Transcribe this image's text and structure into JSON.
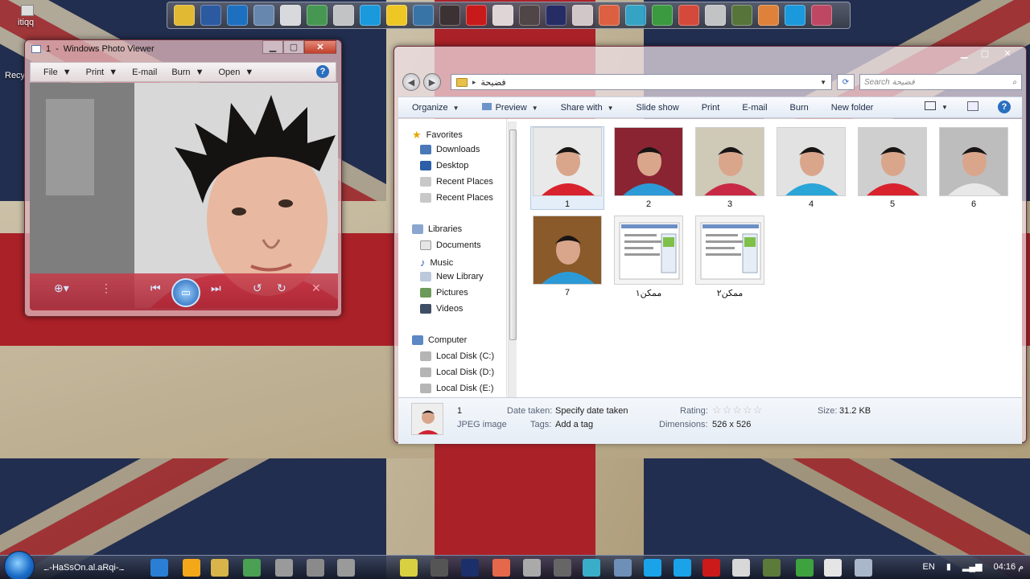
{
  "desktop": {
    "icons": [
      {
        "label": "itiqq"
      },
      {
        "label": "Recy"
      }
    ]
  },
  "top_dock": {
    "icons": [
      "explorer-icon",
      "network-icon",
      "cube-icon",
      "monitor-icon",
      "runner-icon",
      "game-icon",
      "clock-icon",
      "skype-icon",
      "chrome-icon",
      "bird-icon",
      "app-icon",
      "red-app-icon",
      "smile-icon",
      "pie-icon",
      "hd-icon",
      "gray-icon",
      "palm-icon",
      "window-icon",
      "camtasia-icon",
      "chrome2-icon",
      "window2-icon",
      "game2-icon",
      "mask-icon",
      "skype2-icon",
      "flower-icon"
    ]
  },
  "photo_viewer": {
    "title_num": "1",
    "title": "Windows Photo Viewer",
    "menu": {
      "file": "File",
      "print": "Print",
      "email": "E-mail",
      "burn": "Burn",
      "open": "Open"
    },
    "help": "?"
  },
  "explorer": {
    "address": "فضيحة",
    "search_placeholder": "Search فضيحة",
    "toolbar": {
      "organize": "Organize",
      "preview": "Preview",
      "share_with": "Share with",
      "slide_show": "Slide show",
      "print": "Print",
      "email": "E-mail",
      "burn": "Burn",
      "new_folder": "New folder"
    },
    "nav": {
      "favorites": "Favorites",
      "downloads": "Downloads",
      "desktop": "Desktop",
      "recent1": "Recent Places",
      "recent2": "Recent Places",
      "libraries": "Libraries",
      "documents": "Documents",
      "music": "Music",
      "new_library": "New Library",
      "pictures": "Pictures",
      "videos": "Videos",
      "computer": "Computer",
      "disk_c": "Local Disk (C:)",
      "disk_d": "Local Disk (D:)",
      "disk_e": "Local Disk (E:)"
    },
    "files": [
      {
        "label": "1"
      },
      {
        "label": "2"
      },
      {
        "label": "3"
      },
      {
        "label": "4"
      },
      {
        "label": "5"
      },
      {
        "label": "6"
      },
      {
        "label": "7"
      },
      {
        "label": "ممكن١"
      },
      {
        "label": "ممكن٢"
      }
    ],
    "details": {
      "name": "1",
      "type": "JPEG image",
      "date_taken_label": "Date taken:",
      "date_taken_value": "Specify date taken",
      "tags_label": "Tags:",
      "tags_value": "Add a tag",
      "rating_label": "Rating:",
      "rating_value": 0,
      "dimensions_label": "Dimensions:",
      "dimensions_value": "526 x 526",
      "size_label": "Size:",
      "size_value": "31.2 KB"
    }
  },
  "taskbar": {
    "user_text": "ـ.-HaSsOn.al.aRqi-.ـ",
    "language": "EN",
    "time": "04:16 م"
  }
}
